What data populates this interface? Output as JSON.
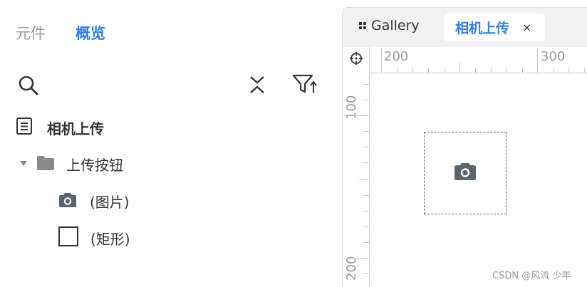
{
  "left_panel": {
    "tabs": [
      {
        "label": "元件"
      },
      {
        "label": "概览"
      }
    ],
    "tree": [
      {
        "label": "相机上传"
      },
      {
        "label": "上传按钮"
      },
      {
        "label": "(图片)"
      },
      {
        "label": "(矩形)"
      }
    ]
  },
  "editor": {
    "tabs": [
      {
        "label": "Gallery"
      },
      {
        "label": "相机上传",
        "close": "×"
      }
    ],
    "ruler": {
      "top_labels": [
        "200",
        "300"
      ],
      "left_labels": [
        "100",
        "200"
      ]
    }
  },
  "watermark": "CSDN @风流 少年",
  "colors": {
    "accent": "#2f7fe6",
    "inactive": "#9a9a9a",
    "icon": "#5a6470"
  }
}
